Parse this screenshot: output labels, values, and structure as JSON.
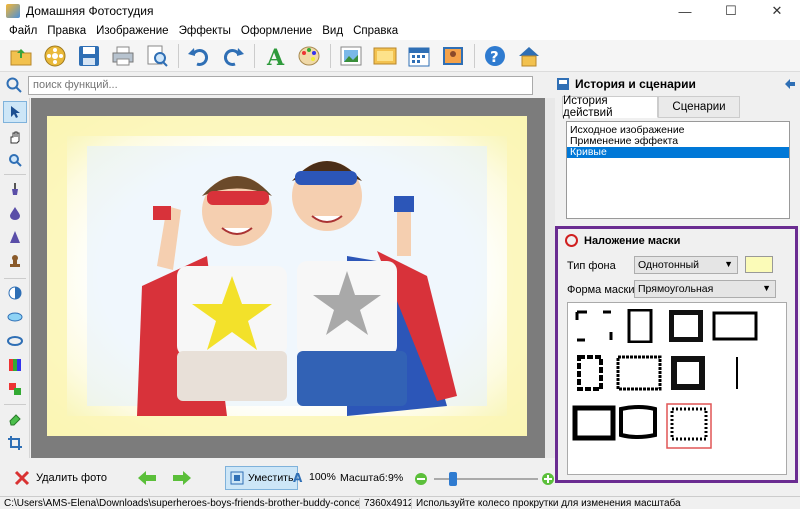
{
  "window": {
    "title": "Домашняя Фотостудия",
    "minimize": "—",
    "maximize": "☐",
    "close": "✕"
  },
  "menu": [
    "Файл",
    "Правка",
    "Изображение",
    "Эффекты",
    "Оформление",
    "Вид",
    "Справка"
  ],
  "toolbar": {
    "icons": [
      "open-folder-icon",
      "film-reel-icon",
      "save-disk-icon",
      "print-icon",
      "zoom-doc-icon",
      "undo-icon",
      "redo-icon",
      "text-a-icon",
      "palette-icon",
      "photo-frame-icon",
      "landscape-icon",
      "calendar-icon",
      "photo-collage-icon",
      "help-icon",
      "home-icon"
    ]
  },
  "search": {
    "placeholder": "поиск функций..."
  },
  "right_panel": {
    "title": "История и сценарии",
    "tabs": [
      "История действий",
      "Сценарии"
    ],
    "history": [
      "Исходное изображение",
      "Применение эффекта",
      "Кривые"
    ],
    "selected_history": "Кривые"
  },
  "mask_panel": {
    "title": "Наложение маски",
    "bg_type_label": "Тип фона",
    "bg_type_value": "Однотонный",
    "bg_color": "#fbfbb8",
    "mask_shape_label": "Форма маски",
    "mask_shape_value": "Прямоугольная",
    "accent": "#6a2c91"
  },
  "bottom": {
    "delete_label": "Удалить фото",
    "fit_label": "Уместить",
    "zoom_100": "100%",
    "scale_label": "Масштаб:",
    "scale_value": "9%"
  },
  "status": {
    "path": "C:\\Users\\AMS-Elena\\Downloads\\superheroes-boys-friends-brother-buddy-concept-PEQB",
    "dimensions": "7360x4912",
    "hint": "Используйте колесо прокрутки для изменения масштаба"
  }
}
